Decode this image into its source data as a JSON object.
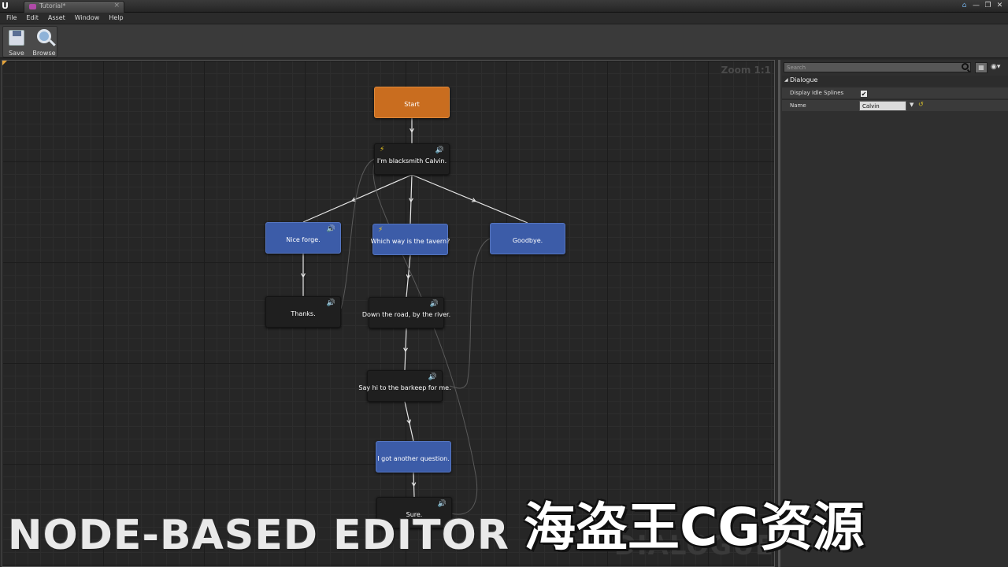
{
  "window": {
    "logo": "U",
    "tab_label": "Tutorial*",
    "tab_close": "×",
    "buttons": [
      "⌂",
      "—",
      "❐",
      "✕"
    ]
  },
  "menu": [
    "File",
    "Edit",
    "Asset",
    "Window",
    "Help"
  ],
  "toolbar": {
    "save_label": "Save",
    "browse_label": "Browse"
  },
  "graph": {
    "zoom": "Zoom 1:1",
    "watermark": "DIALOGUE",
    "colors": {
      "start": "#c96d1f",
      "npc": "#1f1f1f",
      "player": "#3c5ca8",
      "wire": "#e6e6e6"
    },
    "nodes": [
      {
        "id": "start",
        "type": "start",
        "text": "Start",
        "sound": false,
        "event": false
      },
      {
        "id": "n1",
        "type": "npc",
        "text": "I'm blacksmith Calvin.",
        "sound": true,
        "event": true
      },
      {
        "id": "p1",
        "type": "player",
        "text": "Nice forge.",
        "sound": true,
        "event": false
      },
      {
        "id": "p2",
        "type": "player",
        "text": "Which way is the tavern?",
        "sound": false,
        "event": true
      },
      {
        "id": "p3",
        "type": "player",
        "text": "Goodbye.",
        "sound": false,
        "event": false
      },
      {
        "id": "n2",
        "type": "npc",
        "text": "Thanks.",
        "sound": true,
        "event": false
      },
      {
        "id": "n3",
        "type": "npc",
        "text": "Down the road, by the river.",
        "sound": true,
        "event": false
      },
      {
        "id": "n4",
        "type": "npc",
        "text": "Say hi to the barkeep for me.",
        "sound": true,
        "event": false
      },
      {
        "id": "p4",
        "type": "player",
        "text": "I got another question.",
        "sound": false,
        "event": false
      },
      {
        "id": "n5",
        "type": "npc",
        "text": "Sure.",
        "sound": true,
        "event": false
      }
    ],
    "icons": {
      "sound": "speaker-icon",
      "event": "lightning-icon"
    }
  },
  "details": {
    "search_placeholder": "Search",
    "category": "Dialogue",
    "props": {
      "display_idle_splines": {
        "label": "Display Idle Splines",
        "checked": true,
        "mark": "✔"
      },
      "name": {
        "label": "Name",
        "value": "Calvin"
      }
    }
  },
  "overlay": {
    "title": "NODE-BASED EDITOR",
    "watermark": "海盗王CG资源"
  }
}
